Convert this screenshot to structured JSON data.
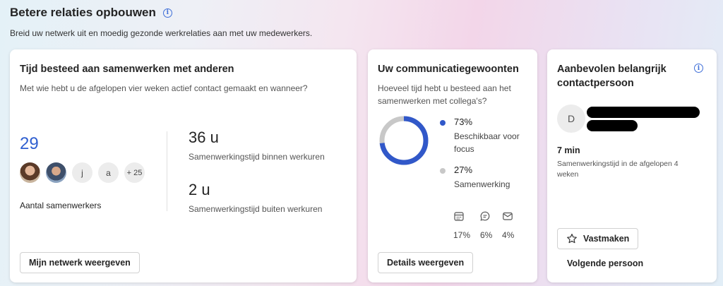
{
  "header": {
    "title": "Betere relaties opbouwen",
    "subtitle": "Breid uw netwerk uit en moedig gezonde werkrelaties aan met uw medewerkers."
  },
  "collab_card": {
    "title": "Tijd besteed aan samenwerken met anderen",
    "description": "Met wie hebt u de afgelopen vier weken actief contact gemaakt en wanneer?",
    "collaborator_count": "29",
    "avatars": [
      "",
      "",
      "j",
      "a",
      "+ 25"
    ],
    "count_label": "Aantal samenwerkers",
    "metrics": [
      {
        "value": "36 u",
        "label": "Samenwerkingstijd binnen werkuren"
      },
      {
        "value": "2 u",
        "label": "Samenwerkingstijd buiten werkuren"
      }
    ],
    "button_label": "Mijn netwerk weergeven"
  },
  "habits_card": {
    "title": "Uw communicatiegewoonten",
    "description": "Hoeveel tijd hebt u besteed aan het samenwerken met collega's?",
    "focus_fraction": 0.73,
    "legend": [
      {
        "pct": "73%",
        "label": "Beschikbaar voor focus",
        "color": "#3158c9"
      },
      {
        "pct": "27%",
        "label": "Samenwerking",
        "color": "#c8c8c8"
      }
    ],
    "channels": [
      {
        "icon": "calendar-icon",
        "pct": "17%"
      },
      {
        "icon": "chat-icon",
        "pct": "6%"
      },
      {
        "icon": "mail-icon",
        "pct": "4%"
      }
    ],
    "button_label": "Details weergeven"
  },
  "contact_card": {
    "title": "Aanbevolen belangrijk contactpersoon",
    "avatar_initial": "D",
    "minutes": "7 min",
    "minutes_description": "Samenwerkingstijd in de afgelopen 4 weken",
    "pin_label": "Vastmaken",
    "next_label": "Volgende persoon"
  },
  "colors": {
    "accent": "#2f5fd0",
    "donut_focus": "#3158c9",
    "donut_collab": "#c8c8c8"
  }
}
